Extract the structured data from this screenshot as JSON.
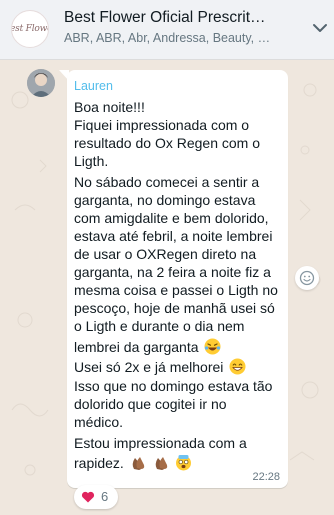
{
  "header": {
    "avatar_logo_text": "Best Flower",
    "title": "Best Flower Oficial Prescrit…",
    "subtitle": "ABR, ABR, Abr, Andressa, Beauty, …",
    "header_icon": "chevron-down-icon"
  },
  "message": {
    "sender": "Lauren",
    "sender_color": "#53bdeb",
    "lines": [
      "Boa noite!!!",
      "Fiquei impressionada com o",
      "resultado do Ox Regen com o",
      "Ligth.",
      "No sábado comecei a sentir a",
      "garganta,  no domingo estava",
      "com amigdalite e bem dolorido,",
      "estava até febril, a noite lembrei",
      "de usar o OXRegen direto na",
      "garganta, na 2 feira a noite fiz a",
      "mesma coisa e passei o Ligth no",
      "pescoço, hoje de manhã usei só",
      "o Ligth e durante o dia nem",
      "lembrei da garganta",
      "Usei só 2x e  já melhorei",
      "Isso que no domingo estava tão",
      "dolorido que cogitei ir no",
      "médico.",
      "Estou impressionada com a",
      "rapidez."
    ],
    "time": "22:28"
  },
  "reaction": {
    "emoji": "heart-icon",
    "count": "6"
  },
  "side_icon": "smiley-reaction-icon",
  "colors": {
    "header_bg": "#f0f2f5",
    "chat_bg": "#efe7de",
    "bubble_bg": "#ffffff",
    "heart": "#e0245e"
  }
}
